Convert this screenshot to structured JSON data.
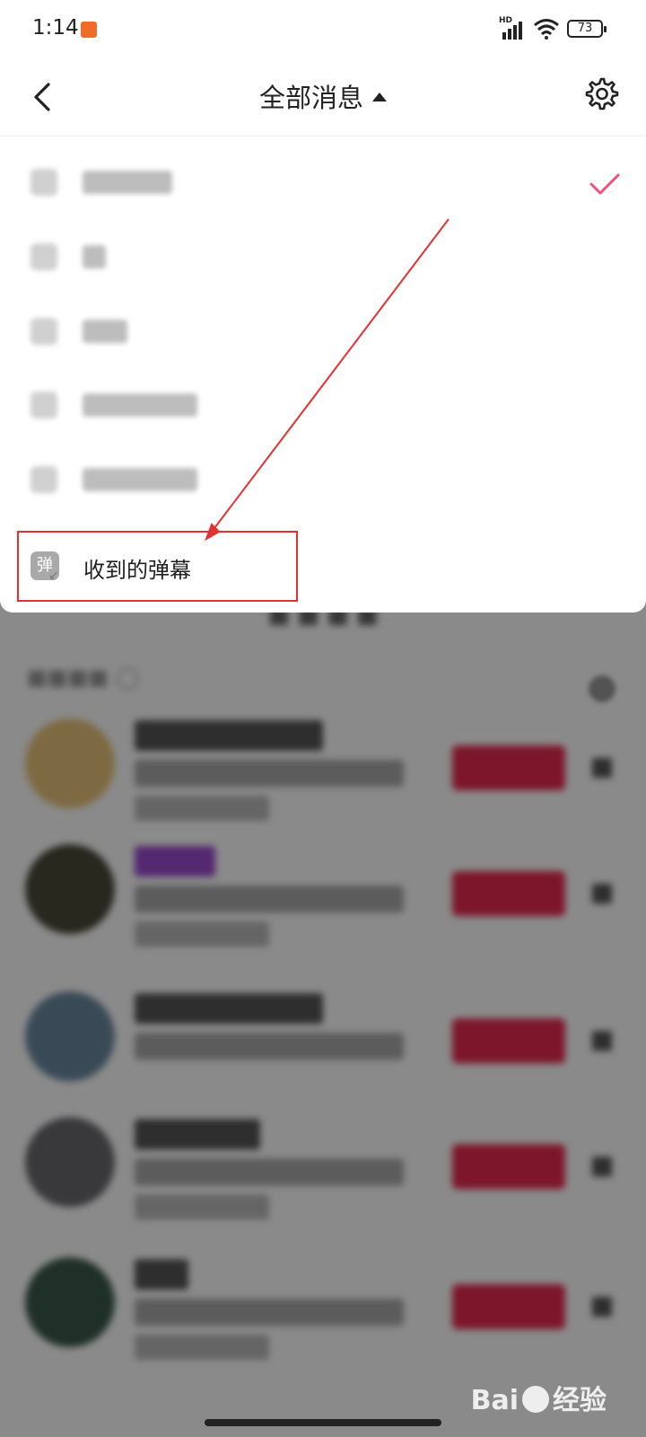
{
  "status": {
    "time": "1:14",
    "network": "HD",
    "battery": "73"
  },
  "header": {
    "title": "全部消息"
  },
  "menu": {
    "items": [
      {
        "label": "",
        "selected": true
      },
      {
        "label": ""
      },
      {
        "label": ""
      },
      {
        "label": ""
      },
      {
        "label": ""
      },
      {
        "label": "收到的弹幕",
        "icon_text": "弹"
      }
    ]
  },
  "watermark": {
    "text_left": "Bai",
    "text_right": "经验"
  },
  "colors": {
    "check": "#f0507a",
    "annotation": "#e53030",
    "button": "#e8294e"
  }
}
